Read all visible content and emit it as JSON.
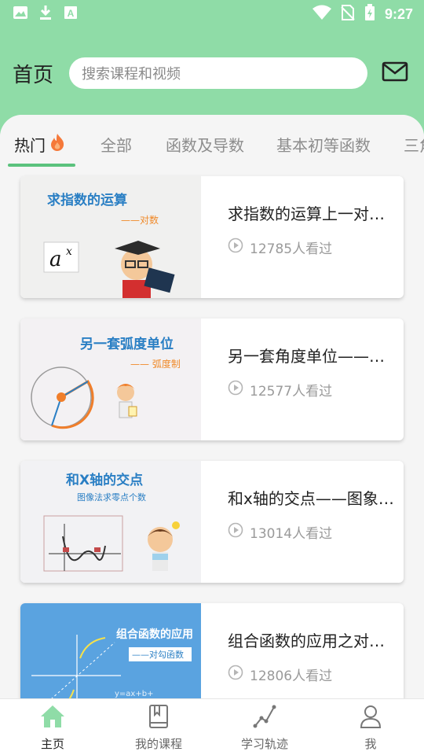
{
  "status_bar": {
    "time": "9:27",
    "icons_left": [
      "image-icon",
      "download-icon",
      "font-icon"
    ],
    "icons_right": [
      "wifi-icon",
      "no-sim-icon",
      "battery-charging-icon"
    ]
  },
  "header": {
    "title": "首页",
    "search_placeholder": "搜索课程和视频",
    "mail_icon": "mail-icon"
  },
  "tabs": [
    {
      "label": "热门",
      "active": true
    },
    {
      "label": "全部",
      "active": false
    },
    {
      "label": "函数及导数",
      "active": false
    },
    {
      "label": "基本初等函数",
      "active": false
    },
    {
      "label": "三角",
      "active": false
    }
  ],
  "cards": [
    {
      "title": "求指数的运算上一对数的运算",
      "views": "12785人看过",
      "thumb": {
        "heading": "求指数的运算",
        "sub": "——对数",
        "formula": "a",
        "exp": "x"
      }
    },
    {
      "title": "另一套角度单位——弧度制",
      "views": "12577人看过",
      "thumb": {
        "heading": "另一套弧度单位",
        "sub": "—— 弧度制"
      }
    },
    {
      "title": "和x轴的交点——图象法求零点个数",
      "views": "13014人看过",
      "thumb": {
        "heading": "和X轴的交点",
        "sub": "图像法求零点个数"
      }
    },
    {
      "title": "组合函数的应用之对勾函数",
      "views": "12806人看过",
      "thumb": {
        "heading": "组合函数的应用",
        "sub": "——对勾函数",
        "formula": "y=ax+b+"
      }
    }
  ],
  "bottom_nav": [
    {
      "label": "主页",
      "icon": "home-icon",
      "active": true
    },
    {
      "label": "我的课程",
      "icon": "book-icon",
      "active": false
    },
    {
      "label": "学习轨迹",
      "icon": "trajectory-icon",
      "active": false
    },
    {
      "label": "我",
      "icon": "user-icon",
      "active": false
    }
  ],
  "colors": {
    "header_bg": "#8fdca7",
    "accent": "#5bc27d",
    "tab_fire": "#f5793a"
  }
}
